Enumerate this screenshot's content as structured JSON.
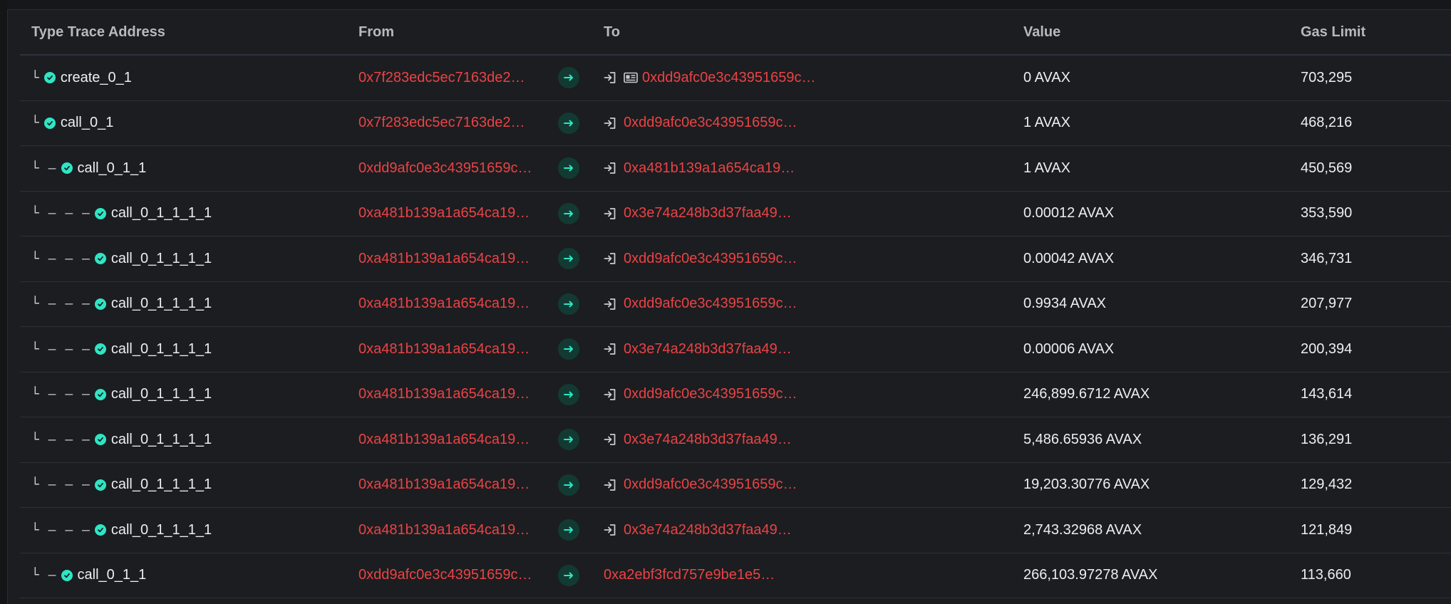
{
  "table": {
    "headers": {
      "type_trace": "Type Trace Address",
      "from": "From",
      "to": "To",
      "value": "Value",
      "gas_limit": "Gas Limit"
    },
    "rows": [
      {
        "prefix": "└",
        "type": "create_0_1",
        "from": "0x7f283edc5ec7163de2…",
        "to": "0xdd9afc0e3c43951659c…",
        "to_icons": [
          "enter-icon",
          "contract-icon"
        ],
        "value": "0 AVAX",
        "gas": "703,295"
      },
      {
        "prefix": "└",
        "type": "call_0_1",
        "from": "0x7f283edc5ec7163de2…",
        "to": "0xdd9afc0e3c43951659c…",
        "to_icons": [
          "enter-icon"
        ],
        "value": "1 AVAX",
        "gas": "468,216"
      },
      {
        "prefix": "└ –",
        "type": "call_0_1_1",
        "from": "0xdd9afc0e3c43951659c…",
        "to": "0xa481b139a1a654ca19…",
        "to_icons": [
          "enter-icon"
        ],
        "value": "1 AVAX",
        "gas": "450,569"
      },
      {
        "prefix": "└ – – –",
        "type": "call_0_1_1_1_1",
        "from": "0xa481b139a1a654ca19…",
        "to": "0x3e74a248b3d37faa49…",
        "to_icons": [
          "enter-icon"
        ],
        "value": "0.00012 AVAX",
        "gas": "353,590"
      },
      {
        "prefix": "└ – – –",
        "type": "call_0_1_1_1_1",
        "from": "0xa481b139a1a654ca19…",
        "to": "0xdd9afc0e3c43951659c…",
        "to_icons": [
          "enter-icon"
        ],
        "value": "0.00042 AVAX",
        "gas": "346,731"
      },
      {
        "prefix": "└ – – –",
        "type": "call_0_1_1_1_1",
        "from": "0xa481b139a1a654ca19…",
        "to": "0xdd9afc0e3c43951659c…",
        "to_icons": [
          "enter-icon"
        ],
        "value": "0.9934 AVAX",
        "gas": "207,977"
      },
      {
        "prefix": "└ – – –",
        "type": "call_0_1_1_1_1",
        "from": "0xa481b139a1a654ca19…",
        "to": "0x3e74a248b3d37faa49…",
        "to_icons": [
          "enter-icon"
        ],
        "value": "0.00006 AVAX",
        "gas": "200,394"
      },
      {
        "prefix": "└ – – –",
        "type": "call_0_1_1_1_1",
        "from": "0xa481b139a1a654ca19…",
        "to": "0xdd9afc0e3c43951659c…",
        "to_icons": [
          "enter-icon"
        ],
        "value": "246,899.6712 AVAX",
        "gas": "143,614"
      },
      {
        "prefix": "└ – – –",
        "type": "call_0_1_1_1_1",
        "from": "0xa481b139a1a654ca19…",
        "to": "0x3e74a248b3d37faa49…",
        "to_icons": [
          "enter-icon"
        ],
        "value": "5,486.65936 AVAX",
        "gas": "136,291"
      },
      {
        "prefix": "└ – – –",
        "type": "call_0_1_1_1_1",
        "from": "0xa481b139a1a654ca19…",
        "to": "0xdd9afc0e3c43951659c…",
        "to_icons": [
          "enter-icon"
        ],
        "value": "19,203.30776 AVAX",
        "gas": "129,432"
      },
      {
        "prefix": "└ – – –",
        "type": "call_0_1_1_1_1",
        "from": "0xa481b139a1a654ca19…",
        "to": "0x3e74a248b3d37faa49…",
        "to_icons": [
          "enter-icon"
        ],
        "value": "2,743.32968 AVAX",
        "gas": "121,849"
      },
      {
        "prefix": "└ –",
        "type": "call_0_1_1",
        "from": "0xdd9afc0e3c43951659c…",
        "to": "0xa2ebf3fcd757e9be1e5…",
        "to_icons": [],
        "value": "266,103.97278 AVAX",
        "gas": "113,660"
      }
    ]
  },
  "icons": {
    "status": "check-circle-icon",
    "direction": "arrow-right-icon",
    "enter": "enter-icon",
    "contract": "contract-icon"
  },
  "colors": {
    "address": "#ea4346",
    "success": "#2ee6c4",
    "arrow_bg": "#123a33",
    "background": "#1c1d20"
  }
}
